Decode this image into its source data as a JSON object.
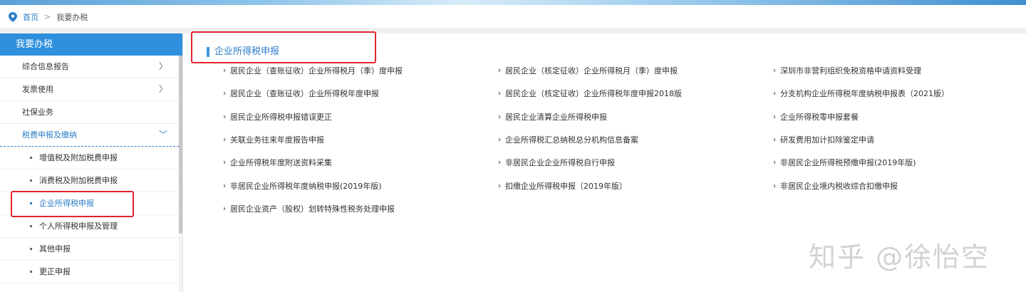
{
  "breadcrumb": {
    "home": "首页",
    "separator": ">",
    "current": "我要办税"
  },
  "sidebar": {
    "title": "我要办税",
    "items": [
      {
        "label": "综合信息报告",
        "chevron": "〉"
      },
      {
        "label": "发票使用",
        "chevron": "〉"
      },
      {
        "label": "社保业务",
        "chevron": ""
      },
      {
        "label": "税费申报及缴纳",
        "chevron": "﹀"
      }
    ],
    "subitems": [
      {
        "label": "增值税及附加税费申报"
      },
      {
        "label": "消费税及附加税费申报"
      },
      {
        "label": "企业所得税申报"
      },
      {
        "label": "个人所得税申报及管理"
      },
      {
        "label": "其他申报"
      },
      {
        "label": "更正申报"
      }
    ]
  },
  "main": {
    "section_title": "企业所得税申报",
    "links": [
      [
        "居民企业（查账征收）企业所得税月（季）度申报",
        "居民企业（核定征收）企业所得税月（季）度申报",
        "深圳市非营利组织免税资格申请资料受理"
      ],
      [
        "居民企业（查账征收）企业所得税年度申报",
        "居民企业（核定征收）企业所得税年度申报2018版",
        "分支机构企业所得税年度纳税申报表（2021版）"
      ],
      [
        "居民企业所得税申报错误更正",
        "居民企业清算企业所得税申报",
        "企业所得税零申报套餐"
      ],
      [
        "关联业务往来年度报告申报",
        "企业所得税汇总纳税总分机构信息备案",
        "研发费用加计扣除鉴定申请"
      ],
      [
        "企业所得税年度附送资料采集",
        "非居民企业企业所得税自行申报",
        "非居民企业所得税预缴申报(2019年版)"
      ],
      [
        "非居民企业所得税年度纳税申报(2019年版)",
        "扣缴企业所得税申报（2019年版）",
        "非居民企业境内税收综合扣缴申报"
      ],
      [
        "居民企业资产（股权）划转特殊性税务处理申报",
        "",
        ""
      ]
    ]
  },
  "watermark": "知乎 @徐怡空",
  "colors": {
    "accent": "#2e8fdc",
    "link_active": "#2b7dc7",
    "highlight_box": "#e1252c"
  }
}
